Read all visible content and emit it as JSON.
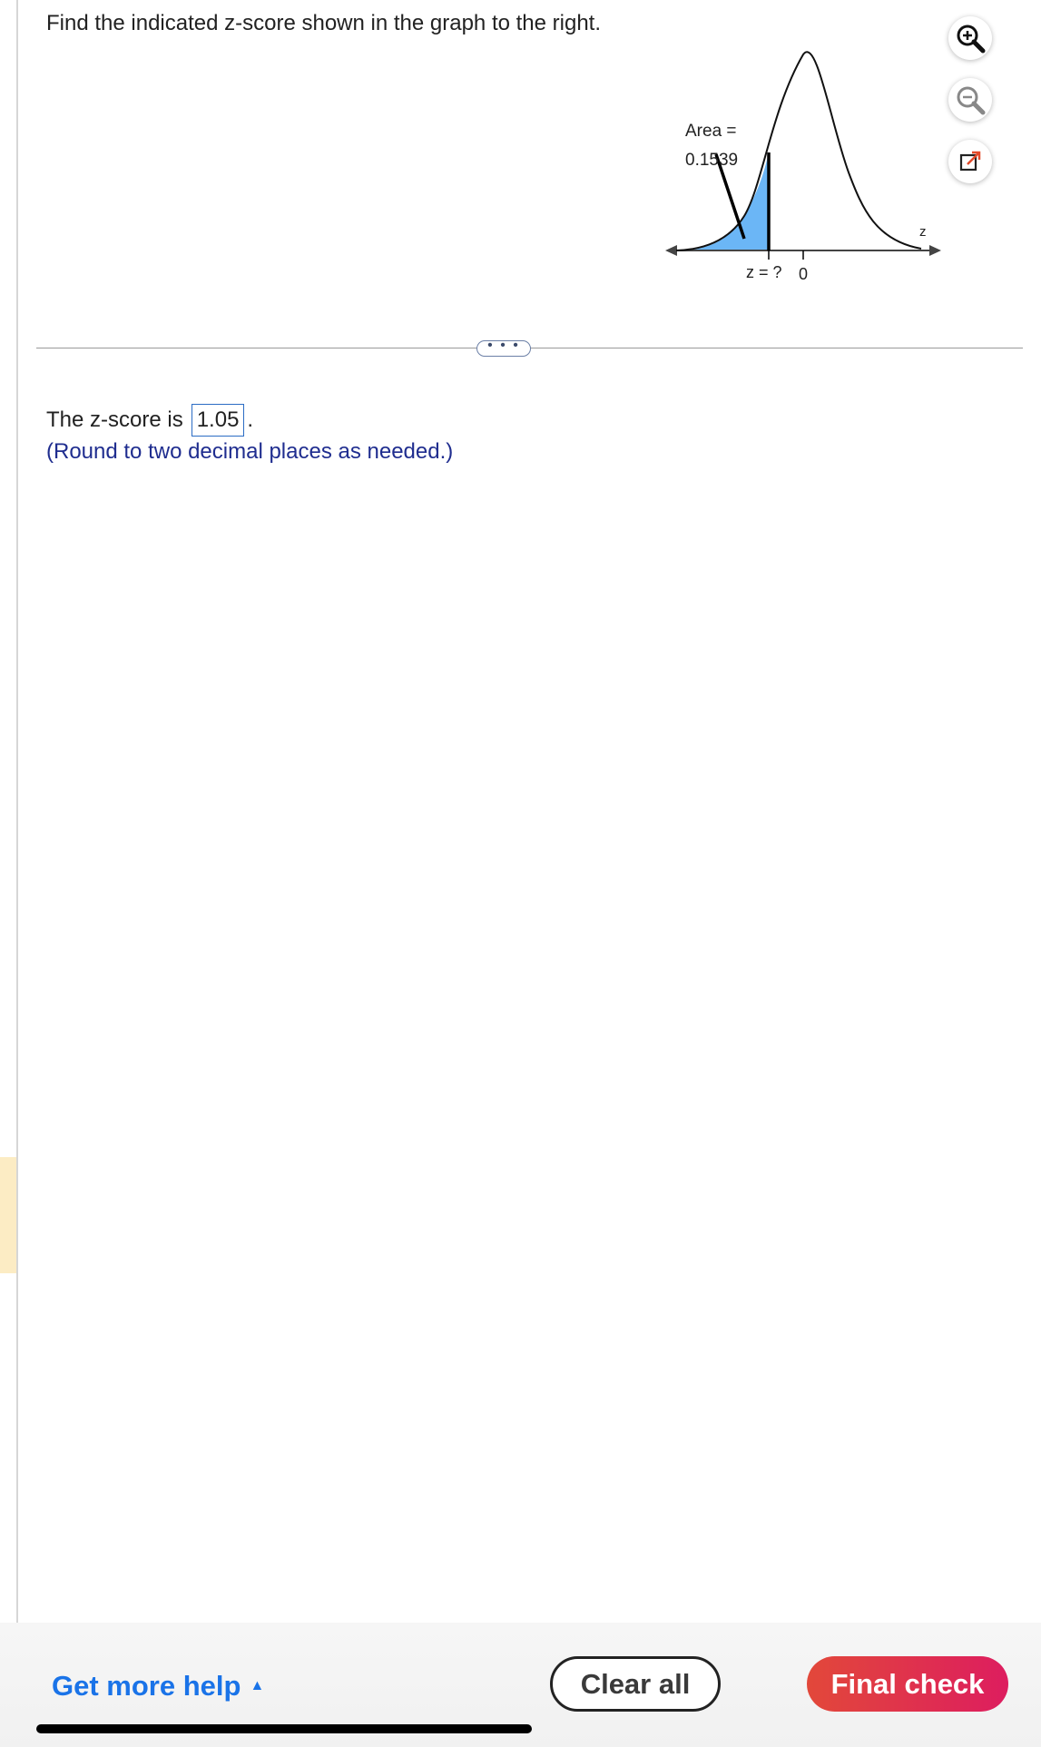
{
  "question": {
    "text": "Find the indicated z-score shown in the graph to the right."
  },
  "graph": {
    "area_label": "Area =",
    "area_value": "0.1539",
    "z_unknown_label": "z = ?",
    "zero_label": "0",
    "axis_label": "z",
    "shade_color": "#6bb6f6"
  },
  "tools": [
    "zoom-in-icon",
    "zoom-out-icon",
    "popout-icon"
  ],
  "divider": {
    "more_label": "• • •"
  },
  "answer": {
    "prefix": "The z-score is",
    "value": "1.05",
    "suffix": ".",
    "hint": "(Round to two decimal places as needed.)"
  },
  "footer": {
    "help_label": "Get more help",
    "clear_label": "Clear all",
    "final_label": "Final check"
  }
}
